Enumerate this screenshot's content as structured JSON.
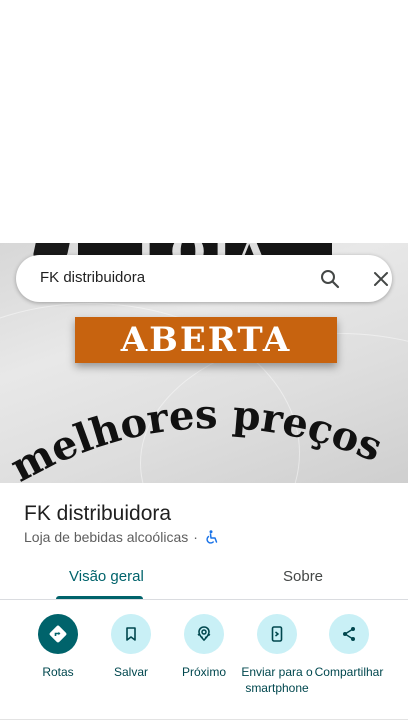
{
  "search": {
    "query": "FK distribuidora"
  },
  "hero": {
    "banner_top_text": "LOJA",
    "banner_text": "ABERTA",
    "curved_text": "melhores preços"
  },
  "place": {
    "name": "FK distribuidora",
    "category": "Loja de bebidas alcoólicas",
    "separator": "·"
  },
  "tabs": [
    {
      "label": "Visão geral",
      "active": true
    },
    {
      "label": "Sobre",
      "active": false
    }
  ],
  "actions": [
    {
      "label": "Rotas",
      "icon": "directions-icon"
    },
    {
      "label": "Salvar",
      "icon": "bookmark-icon"
    },
    {
      "label": "Próximo",
      "icon": "nearby-icon"
    },
    {
      "label": "Enviar para o smartphone",
      "icon": "send-to-phone-icon"
    },
    {
      "label": "Compartilhar",
      "icon": "share-icon"
    }
  ],
  "colors": {
    "accent": "#00636b",
    "chip_bg": "#c9f0f6",
    "banner_orange": "#c7630f"
  }
}
